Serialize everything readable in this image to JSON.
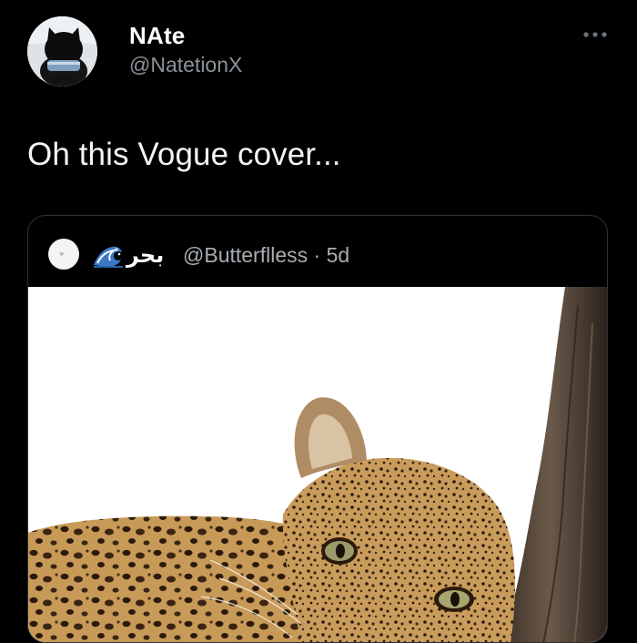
{
  "tweet": {
    "display_name": "NAte",
    "handle": "@NatetionX",
    "text": "Oh this Vogue cover...",
    "more_icon": "more-horizontal-icon"
  },
  "quoted_tweet": {
    "author_name": "بحر",
    "author_emoji": "wave-emoji",
    "handle": "@Butterflless",
    "separator": "·",
    "age": "5d",
    "media_subject": "leopard resting against tree trunk"
  },
  "colors": {
    "background": "#000000",
    "primary_text": "#e7e9ea",
    "secondary_text": "#8b9298",
    "card_border": "#2f3336"
  }
}
